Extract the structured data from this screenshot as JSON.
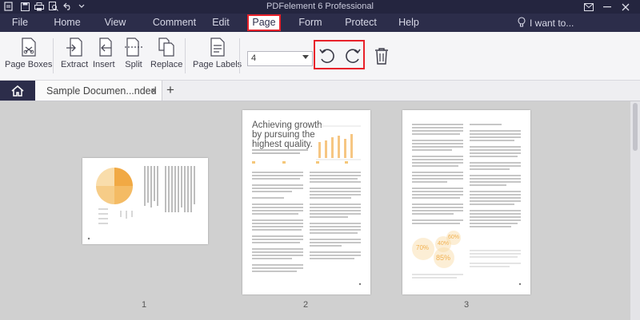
{
  "app": {
    "title": "PDFelement 6 Professional"
  },
  "menu": {
    "items": [
      "File",
      "Home",
      "View",
      "Comment",
      "Edit",
      "Page",
      "Form",
      "Protect",
      "Help"
    ],
    "active": "Page",
    "search_placeholder": "I want to..."
  },
  "ribbon": {
    "page_boxes": "Page Boxes",
    "extract": "Extract",
    "insert": "Insert",
    "split": "Split",
    "replace": "Replace",
    "page_labels": "Page Labels",
    "page_selector_value": "4"
  },
  "tabs": {
    "document_tab": "Sample Documen...nded",
    "add_tab": "+",
    "close": "×"
  },
  "pages": {
    "p1": {
      "number": "1"
    },
    "p2": {
      "number": "2",
      "heading_line1": "Achieving growth",
      "heading_line2": "by pursuing the",
      "heading_line3": "highest quality."
    },
    "p3": {
      "number": "3",
      "stat_a": "70%",
      "stat_b": "40%",
      "stat_c": "85%",
      "stat_d": "60%"
    }
  },
  "colors": {
    "titlebar": "#24253f",
    "menubar": "#2c2d4a",
    "highlight": "#e8212a",
    "accent": "#f0a030"
  }
}
